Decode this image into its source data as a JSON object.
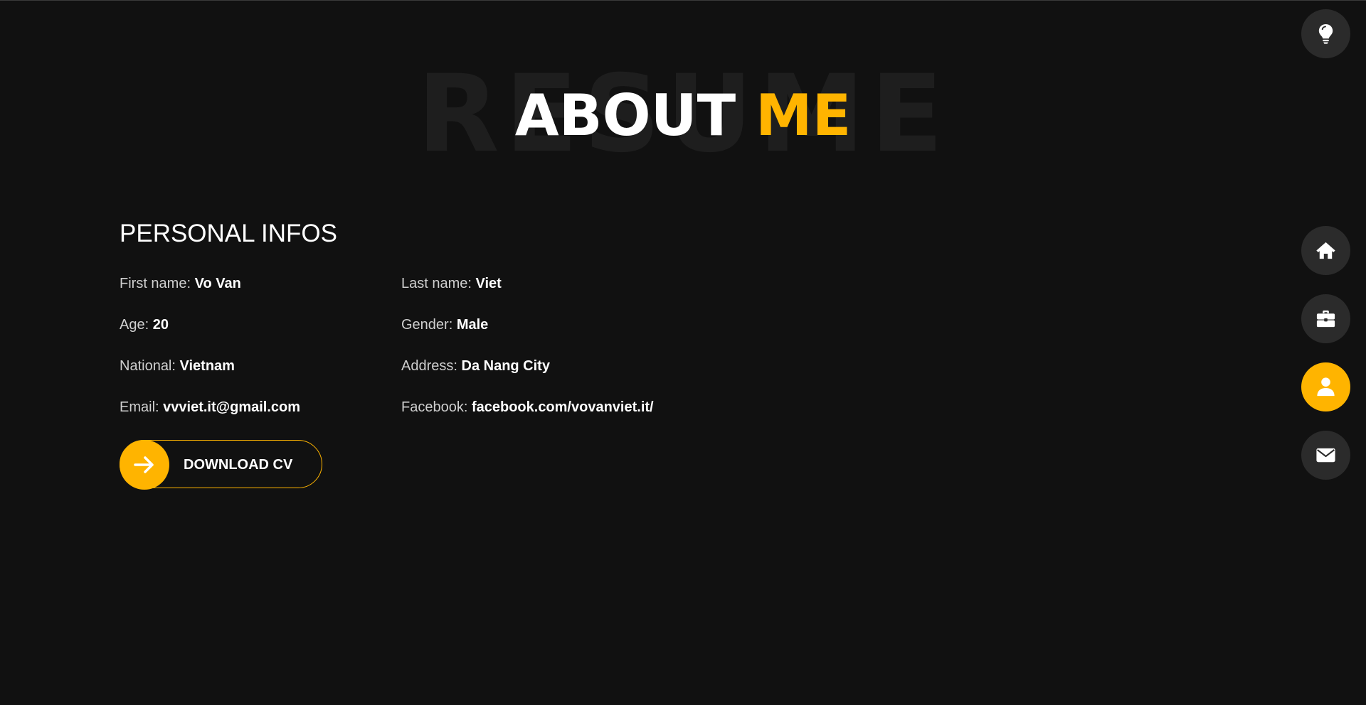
{
  "header": {
    "background_word": "RESUME",
    "title_main": "ABOUT ",
    "title_accent": "ME"
  },
  "personal": {
    "heading": "PERSONAL INFOS",
    "fields": [
      {
        "label": "First name:",
        "value": "Vo Van"
      },
      {
        "label": "Last name:",
        "value": "Viet"
      },
      {
        "label": "Age:",
        "value": "20"
      },
      {
        "label": "Gender:",
        "value": "Male"
      },
      {
        "label": "National:",
        "value": "Vietnam"
      },
      {
        "label": "Address:",
        "value": "Da Nang City"
      },
      {
        "label": "Email:",
        "value": "vvviet.it@gmail.com"
      },
      {
        "label": "Facebook:",
        "value": "facebook.com/vovanviet.it/"
      }
    ],
    "download_label": "DOWNLOAD CV",
    "download_icon": "arrow-right-icon"
  },
  "nav": {
    "theme_toggle_icon": "lightbulb-icon",
    "items": [
      {
        "icon": "home-icon",
        "active": false
      },
      {
        "icon": "briefcase-icon",
        "active": false
      },
      {
        "icon": "user-icon",
        "active": true
      },
      {
        "icon": "envelope-icon",
        "active": false
      }
    ]
  },
  "colors": {
    "background": "#111111",
    "accent": "#ffb400",
    "nav_button": "#2b2b2b",
    "background_word": "#1e1e1e"
  }
}
